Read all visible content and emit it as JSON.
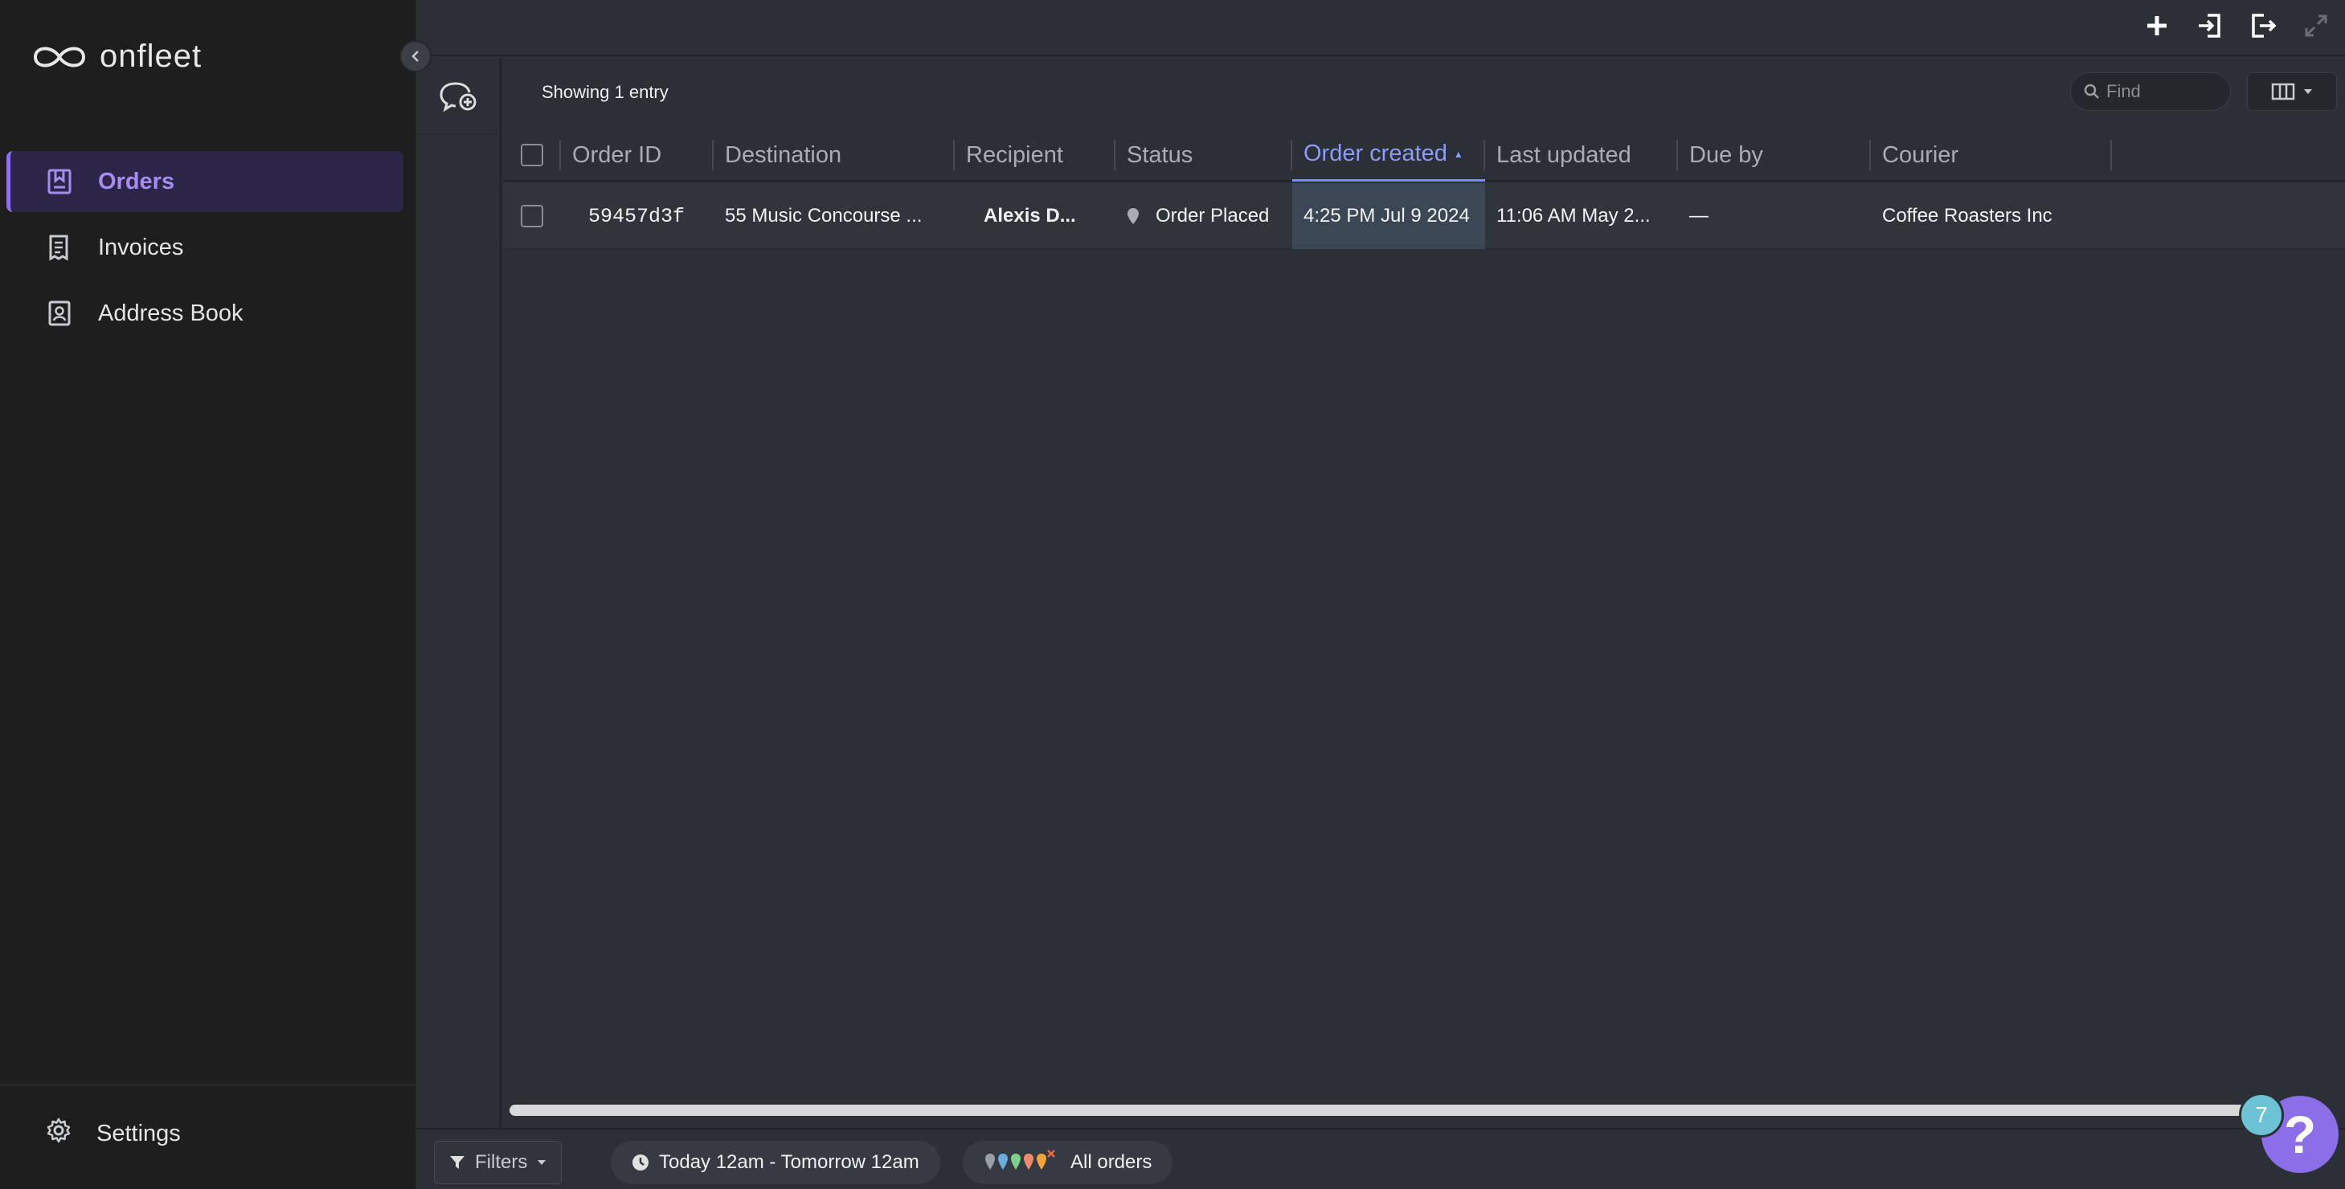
{
  "app": {
    "logo_text": "onfleet"
  },
  "sidebar": {
    "items": [
      {
        "label": "Orders",
        "icon": "orders-icon",
        "active": true
      },
      {
        "label": "Invoices",
        "icon": "invoice-icon",
        "active": false
      },
      {
        "label": "Address Book",
        "icon": "address-book-icon",
        "active": false
      }
    ],
    "settings_label": "Settings"
  },
  "toolbar": {
    "entry_count": "Showing 1 entry",
    "find_placeholder": "Find"
  },
  "table": {
    "columns": [
      "Order ID",
      "Destination",
      "Recipient",
      "Status",
      "Order created",
      "Last updated",
      "Due by",
      "Courier"
    ],
    "sort_indicator": "▲",
    "rows": [
      {
        "order_id": "59457d3f",
        "destination": "55 Music Concourse ...",
        "recipient": "Alexis D...",
        "status": "Order Placed",
        "order_created": "4:25 PM Jul 9 2024",
        "last_updated": "11:06 AM May 2...",
        "due_by": "—",
        "courier": "Coffee Roasters Inc"
      }
    ]
  },
  "bottombar": {
    "filters_label": "Filters",
    "date_range": "Today 12am - Tomorrow 12am",
    "orders_scope": "All orders"
  },
  "help": {
    "badge_count": "7",
    "symbol": "?"
  },
  "colors": {
    "accent": "#8e70ee",
    "sort_accent": "#8c9cf7",
    "sidebar_bg": "#1e1e1e",
    "main_bg": "#2b2f36"
  }
}
